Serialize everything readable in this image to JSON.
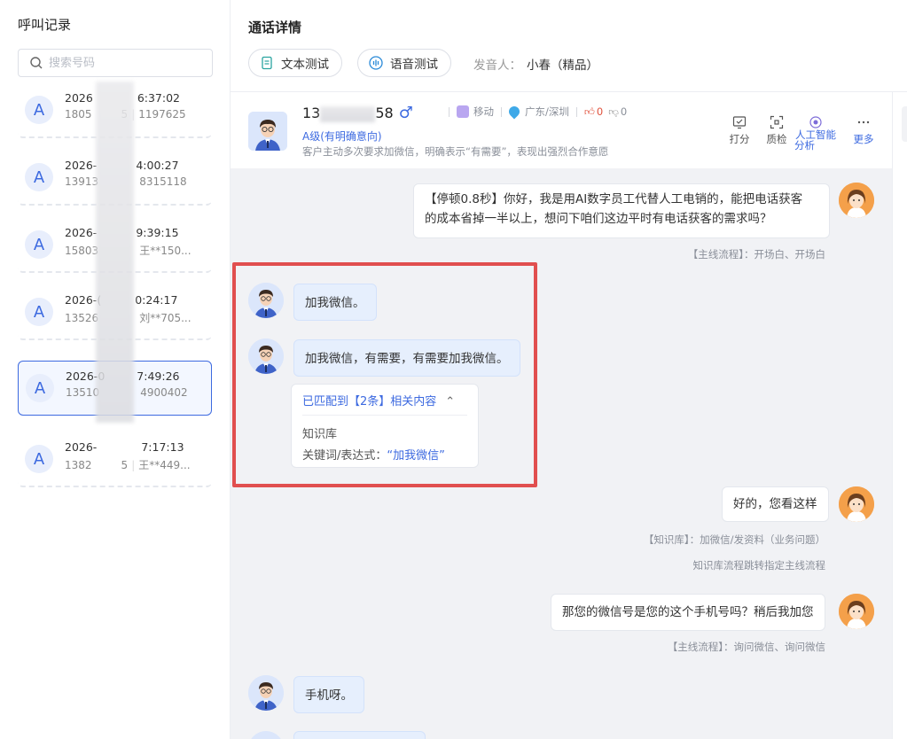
{
  "left": {
    "title": "呼叫记录",
    "search_placeholder": "搜索号码",
    "items": [
      {
        "avatar": "A",
        "time_prefix": "2026",
        "time_suffix": "6:37:02",
        "phone_prefix": "1805",
        "phone_suffix": "5",
        "extra": "1197625",
        "active": false
      },
      {
        "avatar": "A",
        "time_prefix": "2026-",
        "time_suffix": "4:00:27",
        "phone_prefix": "13913",
        "phone_suffix": "",
        "extra": "8315118",
        "active": false
      },
      {
        "avatar": "A",
        "time_prefix": "2026-",
        "time_suffix": "9:39:15",
        "phone_prefix": "15803",
        "phone_suffix": "",
        "extra": "王**150...",
        "active": false
      },
      {
        "avatar": "A",
        "time_prefix": "2026-(",
        "time_suffix": "0:24:17",
        "phone_prefix": "13526",
        "phone_suffix": "",
        "extra": "刘**705...",
        "active": false
      },
      {
        "avatar": "A",
        "time_prefix": "2026-0",
        "time_suffix": "7:49:26",
        "phone_prefix": "13510",
        "phone_suffix": "",
        "extra": "4900402",
        "active": true
      },
      {
        "avatar": "A",
        "time_prefix": "2026-",
        "time_suffix": "7:17:13",
        "phone_prefix": "1382",
        "phone_suffix": "5",
        "extra": "王**449...",
        "active": false
      }
    ]
  },
  "detail": {
    "title": "通话详情",
    "text_test": "文本测试",
    "voice_test": "语音测试",
    "speaker_label": "发音人：",
    "speaker_value": "小春（精品）"
  },
  "header": {
    "phone_prefix": "13",
    "phone_suffix": "58",
    "gender_icon": "♂",
    "carrier": "移动",
    "location": "广东/深圳",
    "likes": "0",
    "dislikes": "0",
    "level": "A级(有明确意向)",
    "desc": "客户主动多次要求加微信，明确表示“有需要”，表现出强烈合作意愿",
    "tools": {
      "dial": "打分",
      "qc": "质检",
      "ai_1": "人工智能",
      "ai_2": "分析",
      "more": "更多"
    }
  },
  "chat": {
    "m1": "【停顿0.8秒】你好，我是用AI数字员工代替人工电销的，能把电话获客的成本省掉一半以上，想问下咱们这边平时有电话获客的需求吗？",
    "m1_line1": "【停顿0.8秒】你好，我是用AI数字员工代替人工电销的，能把电话获客",
    "m1_line2": "的成本省掉一半以上，想问下咱们这边平时有电话获客的需求吗？",
    "t1": "【主线流程】：开场白、开场白",
    "u1": "加我微信。",
    "u2": "加我微信，有需要，有需要加我微信。",
    "match_head": "已匹配到【2条】相关内容",
    "match_caret": "⌃",
    "match_kb": "知识库",
    "match_kw_label": "关键词/表达式：",
    "match_kw_value": "“加我微信”",
    "m2": "好的，您看这样",
    "t2": "【知识库】：加微信/发资料（业务问题）",
    "t2b": "知识库流程跳转指定主线流程",
    "m3": "那您的微信号是您的这个手机号吗？稍后我加您",
    "t3": "【主线流程】：询问微信、询问微信",
    "u3": "手机呀。"
  },
  "colors": {
    "accent": "#3d6ae0",
    "highlight_box": "#e14f4f",
    "user_bubble": "#e6effd",
    "chat_bg": "#f1f2f5"
  }
}
